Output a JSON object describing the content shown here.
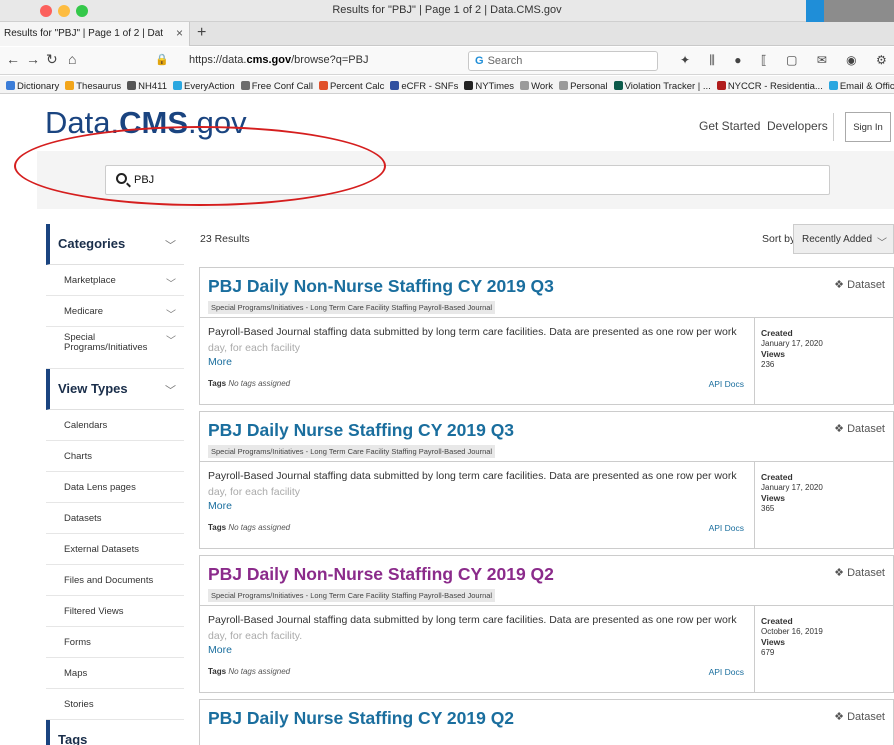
{
  "window": {
    "title": "Results for \"PBJ\" | Page 1 of 2 | Data.CMS.gov"
  },
  "browser": {
    "tab_label": "Results for \"PBJ\" | Page 1 of 2 | Dat",
    "tab_close": "×",
    "new_tab": "+",
    "url_prefix": "https://data.",
    "url_host": "cms.gov",
    "url_path": "/browse?q=PBJ",
    "url_tools": "··· ☐ ☆",
    "search_placeholder": "Search",
    "bookmarks": [
      {
        "label": "Dictionary",
        "color": "#3b7dd8"
      },
      {
        "label": "Thesaurus",
        "color": "#f2a51a"
      },
      {
        "label": "NH411",
        "color": "#555555"
      },
      {
        "label": "EveryAction",
        "color": "#2aa7e0"
      },
      {
        "label": "Free Conf Call",
        "color": "#6c6c6c"
      },
      {
        "label": "Percent Calc",
        "color": "#e0502a"
      },
      {
        "label": "eCFR - SNFs",
        "color": "#3050a0"
      },
      {
        "label": "NYTimes",
        "color": "#222222"
      },
      {
        "label": "Work",
        "color": "#9a9a9a"
      },
      {
        "label": "Personal",
        "color": "#9a9a9a"
      },
      {
        "label": "Violation Tracker | ...",
        "color": "#0c5a4a"
      },
      {
        "label": "NYCCR - Residentia...",
        "color": "#b01c1c"
      },
      {
        "label": "Email & Office",
        "color": "#2aa7e0"
      }
    ]
  },
  "header": {
    "logo_a": "Data.",
    "logo_b": "CMS",
    "logo_c": ".gov",
    "get_started": "Get Started",
    "developers": "Developers",
    "sign_in": "Sign In"
  },
  "search": {
    "value": "PBJ"
  },
  "sidebar": {
    "categories_label": "Categories",
    "categories": [
      "Marketplace",
      "Medicare",
      "Special Programs/Initiatives"
    ],
    "view_types_label": "View Types",
    "view_types": [
      "Calendars",
      "Charts",
      "Data Lens pages",
      "Datasets",
      "External Datasets",
      "Files and Documents",
      "Filtered Views",
      "Forms",
      "Maps",
      "Stories"
    ],
    "tags_label": "Tags"
  },
  "results": {
    "count": "23 Results",
    "sort_label": "Sort by",
    "sort_value": "Recently Added",
    "items": [
      {
        "title": "PBJ Daily Non-Nurse Staffing CY 2019 Q3",
        "category": "Special Programs/Initiatives - Long Term Care Facility Staffing Payroll-Based Journal",
        "type": "Dataset",
        "desc": "Payroll-Based Journal staffing data submitted by long term care facilities. Data are presented as one row per work",
        "desc_fade": "day, for each facility",
        "more": "More",
        "tags_label": "Tags",
        "tags_value": "No tags assigned",
        "api": "API Docs",
        "created_label": "Created",
        "created": "January 17, 2020",
        "views_label": "Views",
        "views": "236"
      },
      {
        "title": "PBJ Daily Nurse Staffing CY 2019 Q3",
        "category": "Special Programs/Initiatives - Long Term Care Facility Staffing Payroll-Based Journal",
        "type": "Dataset",
        "desc": "Payroll-Based Journal staffing data submitted by long term care facilities. Data are presented as one row per work",
        "desc_fade": "day, for each facility",
        "more": "More",
        "tags_label": "Tags",
        "tags_value": "No tags assigned",
        "api": "API Docs",
        "created_label": "Created",
        "created": "January 17, 2020",
        "views_label": "Views",
        "views": "365"
      },
      {
        "title": "PBJ Daily Non-Nurse Staffing CY 2019 Q2",
        "category": "Special Programs/Initiatives - Long Term Care Facility Staffing Payroll-Based Journal",
        "type": "Dataset",
        "desc": "Payroll-Based Journal staffing data submitted by long term care facilities. Data are presented as one row per work",
        "desc_fade": "day, for each facility.",
        "more": "More",
        "tags_label": "Tags",
        "tags_value": "No tags assigned",
        "api": "API Docs",
        "created_label": "Created",
        "created": "October 16, 2019",
        "views_label": "Views",
        "views": "679"
      },
      {
        "title": "PBJ Daily Nurse Staffing CY 2019 Q2",
        "type": "Dataset"
      }
    ]
  }
}
